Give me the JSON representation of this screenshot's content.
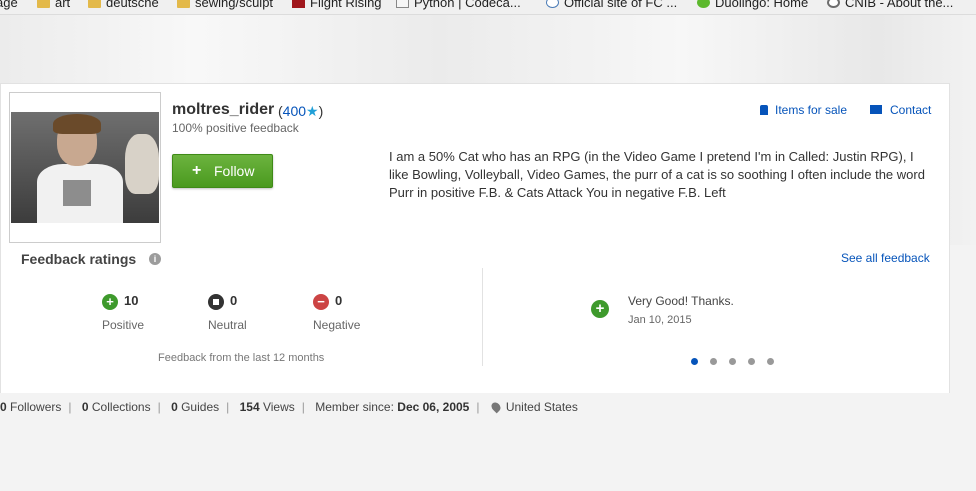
{
  "bookmarks": [
    {
      "label": "age",
      "icon": "page-icon"
    },
    {
      "label": "art",
      "icon": "folder-icon"
    },
    {
      "label": "deutsche",
      "icon": "folder-icon"
    },
    {
      "label": "sewing/sculpt",
      "icon": "folder-icon"
    },
    {
      "label": "Flight Rising",
      "icon": "flight-rising-icon"
    },
    {
      "label": "Python | Codeca...",
      "icon": "python-page-icon"
    },
    {
      "label": "Official site of FC ...",
      "icon": "fc-icon"
    },
    {
      "label": "Duolingo: Home",
      "icon": "duolingo-icon"
    },
    {
      "label": "CNIB - About the...",
      "icon": "cnib-icon"
    }
  ],
  "profile": {
    "username": "moltres_rider",
    "score": "400",
    "score_open": "(",
    "score_close": ")",
    "star": "★",
    "positive_feedback": "100% positive feedback",
    "follow_label": "Follow",
    "items_for_sale": "Items for sale",
    "contact": "Contact",
    "bio": "I am a 50% Cat who has an RPG (in the Video Game I pretend I'm in Called: Justin RPG), I like Bowling, Volleyball, Video Games, the purr of a cat is so soothing I often include the word Purr in positive F.B. & Cats Attack You in negative F.B. Left"
  },
  "feedback": {
    "title": "Feedback ratings",
    "see_all": "See all feedback",
    "positive": {
      "count": "10",
      "label": "Positive"
    },
    "neutral": {
      "count": "0",
      "label": "Neutral"
    },
    "negative": {
      "count": "0",
      "label": "Negative"
    },
    "note": "Feedback from the last 12 months",
    "latest_comment": {
      "text": "Very Good! Thanks.",
      "date": "Jan 10, 2015"
    },
    "carousel_pages": 5,
    "carousel_active": 1
  },
  "stats": {
    "followers_count": "0",
    "followers_label": "Followers",
    "collections_count": "0",
    "collections_label": "Collections",
    "guides_count": "0",
    "guides_label": "Guides",
    "views_count": "154",
    "views_label": "Views",
    "member_since_label": "Member since:",
    "member_since": "Dec 06, 2005",
    "location": "United States"
  },
  "colors": {
    "link": "#0654ba",
    "follow_green": "#4a9a1e",
    "positive_green": "#3e9a2c",
    "negative_red": "#cc4444"
  }
}
